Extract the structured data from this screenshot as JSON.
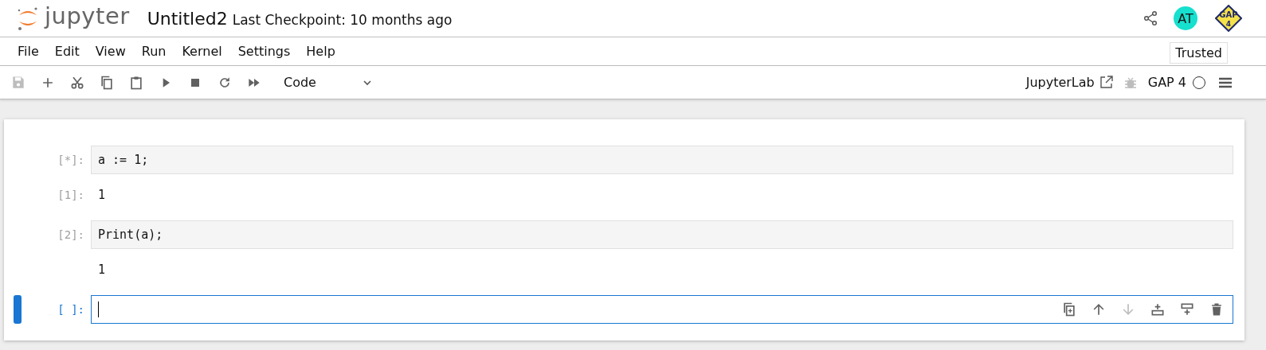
{
  "header": {
    "logo_text": "jupyter",
    "notebook_name": "Untitled2",
    "checkpoint": "Last Checkpoint: 10 months ago",
    "avatar": "AT",
    "kernel_logo": {
      "line1": "GAP",
      "line2": "4"
    }
  },
  "menu": {
    "items": [
      "File",
      "Edit",
      "View",
      "Run",
      "Kernel",
      "Settings",
      "Help"
    ],
    "trusted": "Trusted"
  },
  "toolbar": {
    "buttons": [
      {
        "kind": "save",
        "disabled": true
      },
      {
        "kind": "add",
        "disabled": false
      },
      {
        "kind": "cut",
        "disabled": false
      },
      {
        "kind": "copy",
        "disabled": false
      },
      {
        "kind": "paste",
        "disabled": false
      },
      {
        "kind": "run",
        "disabled": false
      },
      {
        "kind": "stop",
        "disabled": false
      },
      {
        "kind": "restart",
        "disabled": false
      },
      {
        "kind": "run-all",
        "disabled": false
      }
    ],
    "cell_type": "Code",
    "open_in": "JupyterLab",
    "debugger_enabled": false,
    "kernel_name": "GAP 4",
    "kernel_busy": false
  },
  "cells": [
    {
      "kind": "code",
      "prompt": "[*]:",
      "text": "a := 1;",
      "selected": false
    },
    {
      "kind": "output",
      "prompt": "[1]:",
      "text": "1",
      "selected": false
    },
    {
      "kind": "code",
      "prompt": "[2]:",
      "text": "Print(a);",
      "selected": false
    },
    {
      "kind": "output",
      "text": "1",
      "selected": false
    },
    {
      "kind": "code",
      "prompt": "[ ]:",
      "selected": true,
      "cell_tools": [
        {
          "kind": "duplicate",
          "disabled": false
        },
        {
          "kind": "up",
          "disabled": false
        },
        {
          "kind": "down",
          "disabled": true
        },
        {
          "kind": "insert-above",
          "disabled": false
        },
        {
          "kind": "insert-below",
          "disabled": false
        },
        {
          "kind": "delete",
          "disabled": false
        }
      ]
    }
  ]
}
